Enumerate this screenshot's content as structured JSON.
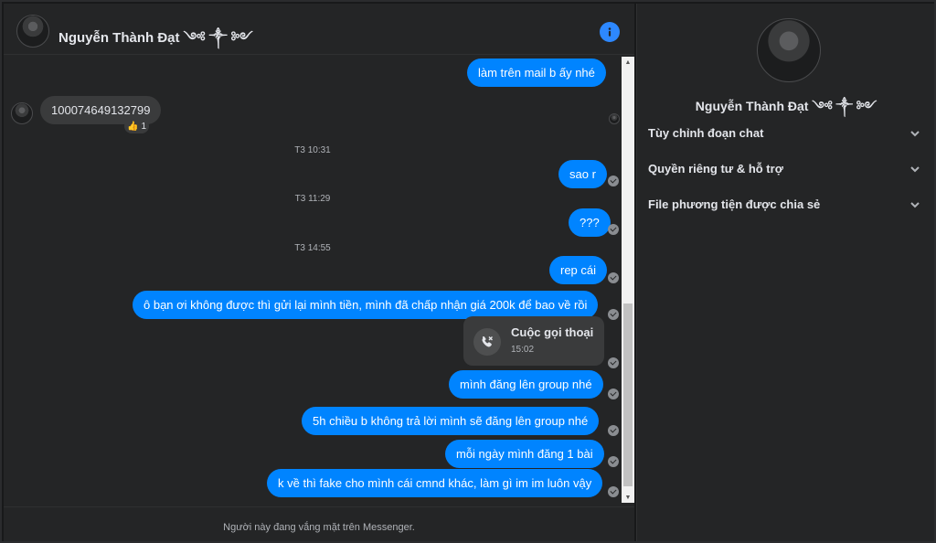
{
  "header": {
    "contact_name": "Nguyễn Thành Đạt ༺ ༒ ༻"
  },
  "messages": [
    {
      "type": "out",
      "text": "làm trên mail b ấy nhé"
    },
    {
      "type": "in",
      "text": "100074649132799",
      "reaction": "1"
    },
    {
      "type": "time",
      "text": "T3 10:31"
    },
    {
      "type": "out",
      "text": "sao r"
    },
    {
      "type": "time",
      "text": "T3 11:29"
    },
    {
      "type": "out",
      "text": "???"
    },
    {
      "type": "time",
      "text": "T3 14:55"
    },
    {
      "type": "out",
      "text": "rep cái"
    },
    {
      "type": "out",
      "text": "ô bạn ơi không được thì gửi lại mình tiền, mình đã chấp nhận giá 200k để bao về rồi"
    },
    {
      "type": "out",
      "text": "mình đăng lên group nhé"
    },
    {
      "type": "out",
      "text": "5h chiều b không trả lời mình sẽ đăng lên group nhé"
    },
    {
      "type": "out",
      "text": "mỗi ngày mình đăng 1 bài"
    },
    {
      "type": "out",
      "text": "k về thì fake cho mình cái cmnd khác, làm gì im im luôn vậy"
    }
  ],
  "call": {
    "title": "Cuộc gọi thoại",
    "time": "15:02"
  },
  "footer": {
    "status": "Người này đang vắng mặt trên Messenger."
  },
  "sidebar": {
    "name": "Nguyễn Thành Đạt ༺ ༒ ༻",
    "items": [
      {
        "label": "Tùy chỉnh đoạn chat"
      },
      {
        "label": "Quyền riêng tư & hỗ trợ"
      },
      {
        "label": "File phương tiện được chia sẻ"
      }
    ]
  },
  "colors": {
    "accent": "#0084ff",
    "info": "#2d88ff",
    "background": "#242526"
  },
  "icons": {
    "info": "info-icon",
    "call": "missed-call-icon",
    "chevron": "chevron-down-icon",
    "seen": "seen-check-icon",
    "reaction": "thumbs-up-icon"
  }
}
